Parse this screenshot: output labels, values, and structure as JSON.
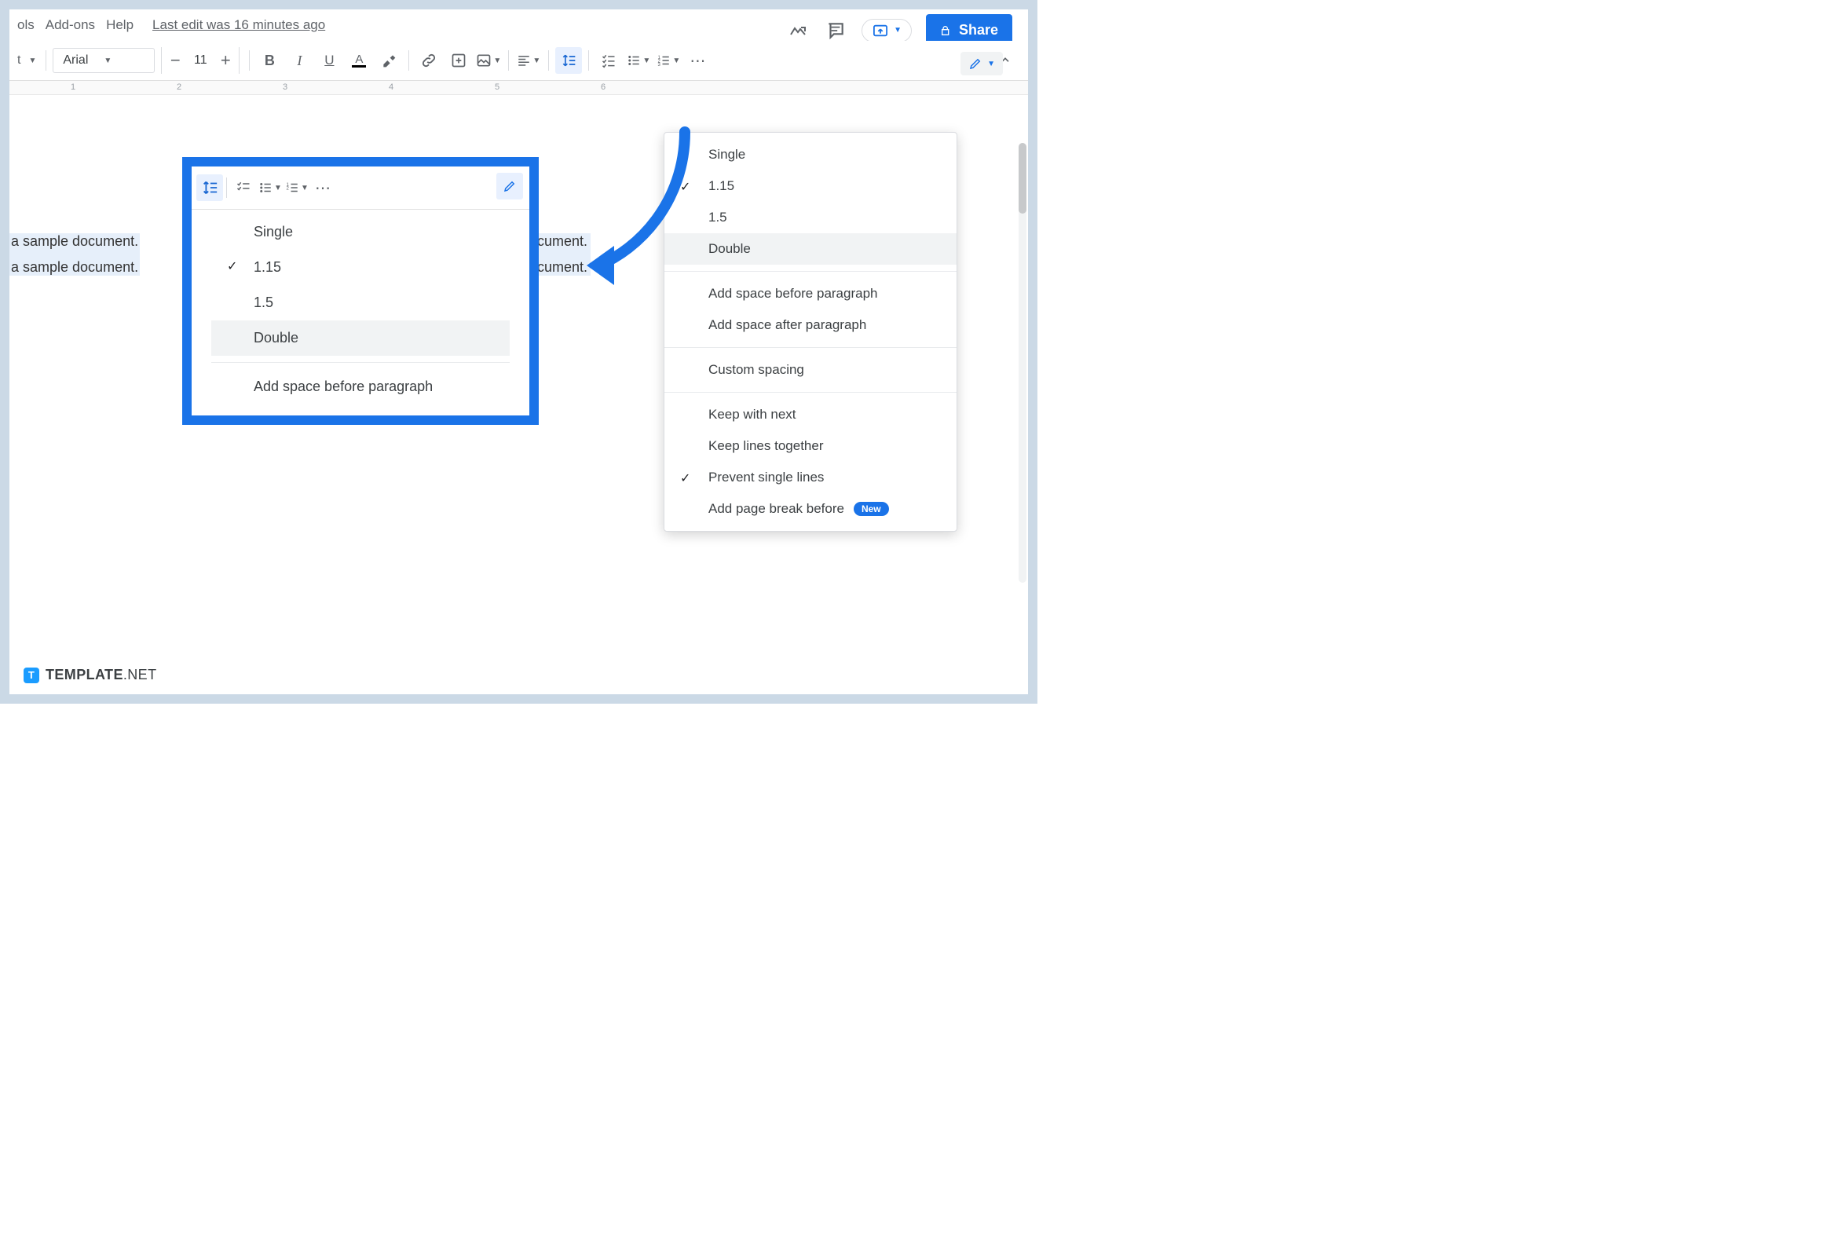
{
  "menubar": {
    "items_left_partial": "ols",
    "items": [
      "Add-ons",
      "Help"
    ],
    "last_edit": "Last edit was 16 minutes ago"
  },
  "top_right": {
    "share_label": "Share"
  },
  "toolbar": {
    "styles_partial": "t",
    "font_name": "Arial",
    "font_size": "11",
    "bold": "B",
    "italic": "I",
    "underline": "U",
    "text_color": "A"
  },
  "ruler_numbers": [
    "1",
    "2",
    "3",
    "4",
    "5",
    "6"
  ],
  "document": {
    "line1": "a sample document.",
    "line2": "a sample document.",
    "rline1": "cument.",
    "rline2": "cument."
  },
  "main_dropdown": {
    "sec1": [
      "Single",
      "1.15",
      "1.5",
      "Double"
    ],
    "checked": "1.15",
    "hovered": "Double",
    "sec2": [
      "Add space before paragraph",
      "Add space after paragraph"
    ],
    "sec3": [
      "Custom spacing"
    ],
    "sec4": [
      "Keep with next",
      "Keep lines together",
      "Prevent single lines",
      "Add page break before"
    ],
    "checked4": "Prevent single lines",
    "badge_label": "New"
  },
  "inset_dropdown": {
    "items": [
      "Single",
      "1.15",
      "1.5",
      "Double"
    ],
    "checked": "1.15",
    "hovered": "Double",
    "sec2": [
      "Add space before paragraph"
    ]
  },
  "footer": {
    "brand_bold": "TEMPLATE",
    "brand_light": ".NET"
  }
}
